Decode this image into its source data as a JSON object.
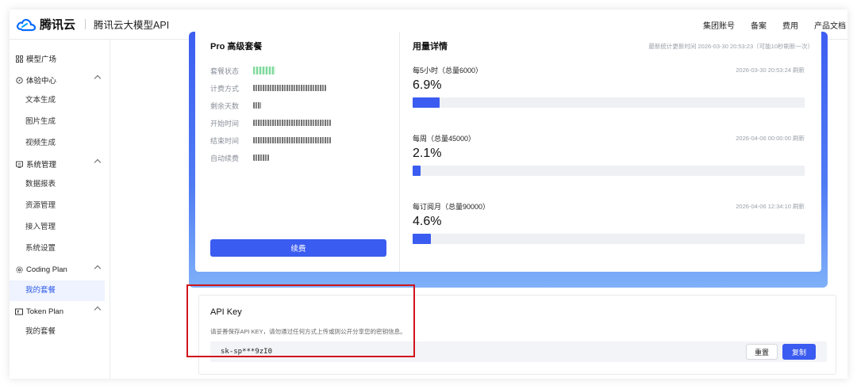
{
  "header": {
    "brand": "腾讯云",
    "product": "腾讯云大模型API",
    "nav": [
      "集团账号",
      "备案",
      "费用",
      "产品文档"
    ]
  },
  "sidebar": {
    "groups": [
      {
        "label": "模型广场",
        "icon": "grid-icon",
        "items": []
      },
      {
        "label": "体验中心",
        "icon": "compass-icon",
        "items": [
          "文本生成",
          "图片生成",
          "视频生成"
        ]
      },
      {
        "label": "系统管理",
        "icon": "system-icon",
        "items": [
          "数据报表",
          "资源管理",
          "接入管理",
          "系统设置"
        ]
      },
      {
        "label": "Coding Plan",
        "icon": "gear-icon",
        "items": [
          "我的套餐"
        ]
      },
      {
        "label": "Token Plan",
        "icon": "token-icon",
        "items": [
          "我的套餐"
        ]
      }
    ],
    "active_item": "我的套餐"
  },
  "plan": {
    "title": "Pro 高级套餐",
    "labels": {
      "status": "套餐状态",
      "billing": "计费方式",
      "remaining_days": "剩余天数",
      "start_time": "开始时间",
      "end_time": "结束时间",
      "auto_renew": "自动续费"
    },
    "renew_button": "续费"
  },
  "usage": {
    "title": "用量详情",
    "meta": "最新统计更新时间 2026-03-30 20:53:23（可能10秒刷新一次）",
    "blocks": [
      {
        "label": "每5小时（总量6000）",
        "time": "2026-03-30 20:53:24 刷新",
        "percent_text": "6.9%",
        "percent": 6.9
      },
      {
        "label": "每周（总量45000）",
        "time": "2026-04-06 00:00:00 刷新",
        "percent_text": "2.1%",
        "percent": 2.1
      },
      {
        "label": "每订阅月（总量90000）",
        "time": "2026-04-06 12:34:10 刷新",
        "percent_text": "4.6%",
        "percent": 4.6
      }
    ]
  },
  "api_key": {
    "title": "API Key",
    "description": "请妥善保存API KEY，请勿通过任何方式上传或则公开分享您的密钥信息。",
    "value": "sk-sp***9zI0",
    "reset_label": "重置",
    "copy_label": "复制"
  },
  "colors": {
    "accent": "#3b5cf0",
    "highlight": "#d0151c",
    "active_bg": "#eef3ff"
  }
}
